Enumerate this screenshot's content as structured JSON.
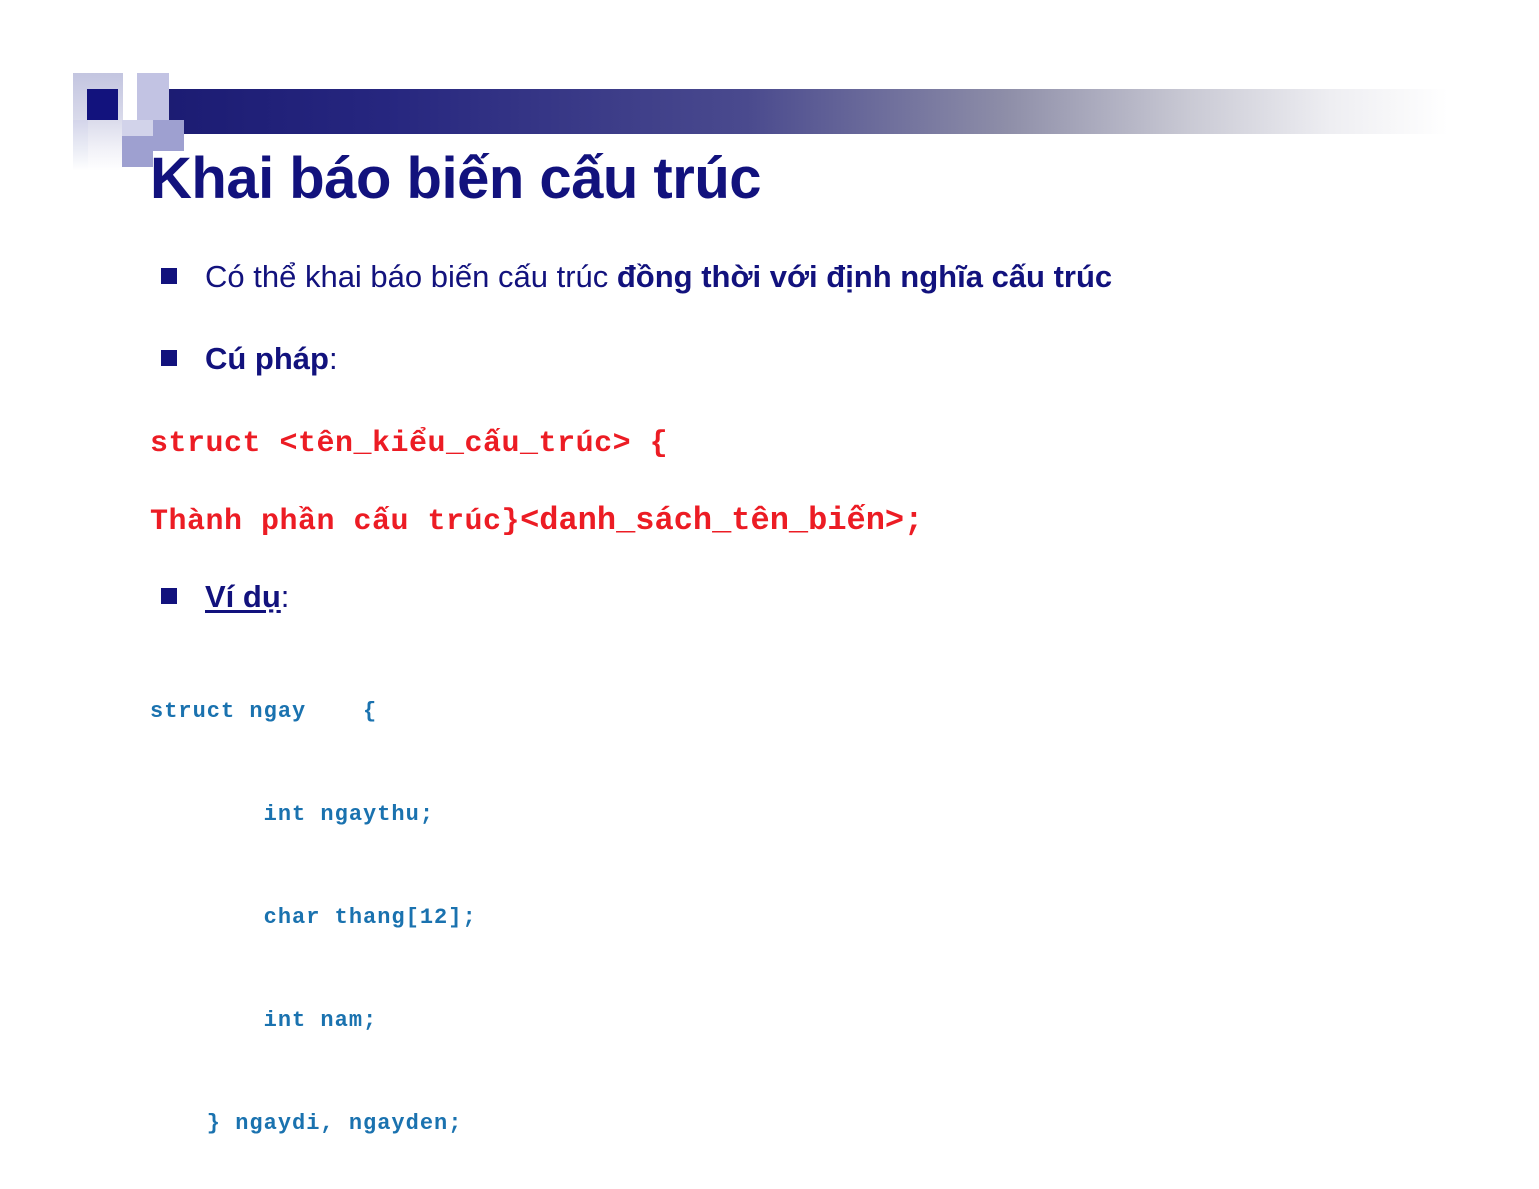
{
  "slide": {
    "title": "Khai báo biến cấu trúc",
    "accent_navy": "#12127d",
    "accent_red": "#ec1c24",
    "accent_blue": "#1a72af",
    "background": "#ffffff"
  },
  "bullets": [
    {
      "id": "bullet-declare-with-definition",
      "plain_prefix": "Có thể khai báo biến cấu trúc ",
      "bold_part": "đồng thời với định nghĩa cấu trúc",
      "suffix": ""
    },
    {
      "id": "bullet-syntax",
      "bold_part": "Cú pháp",
      "suffix": ":"
    },
    {
      "id": "bullet-example",
      "underlined_part": "Ví dụ",
      "suffix": ":"
    }
  ],
  "syntax_block": {
    "line1": "struct <tên_kiểu_cấu_trúc> {",
    "line2_head": "Thành phần cấu trúc}",
    "line2_tail": "<danh_sách_tên_biến>;"
  },
  "example_code": {
    "lines": [
      "struct ngay    {",
      "        int ngaythu;",
      "        char thang[12];",
      "        int nam;",
      "    } ngaydi, ngayden;"
    ]
  }
}
